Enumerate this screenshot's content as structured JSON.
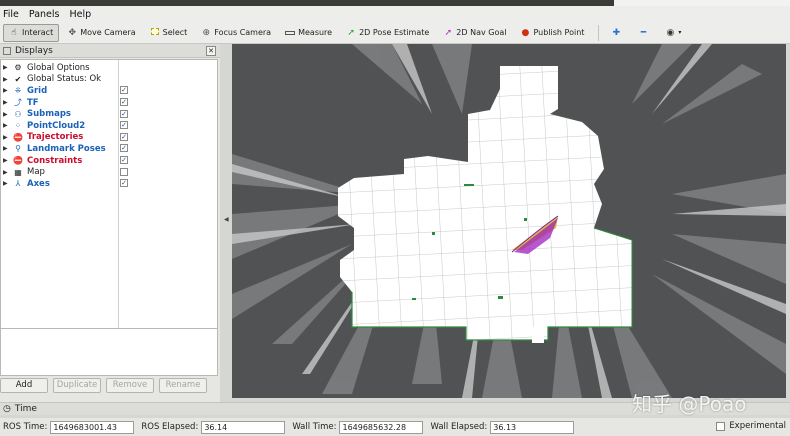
{
  "menu": {
    "file": "File",
    "panels": "Panels",
    "help": "Help"
  },
  "toolbar": {
    "interact": "Interact",
    "move_camera": "Move Camera",
    "select": "Select",
    "focus_camera": "Focus Camera",
    "measure": "Measure",
    "pose_estimate": "2D Pose Estimate",
    "nav_goal": "2D Nav Goal",
    "publish_point": "Publish Point"
  },
  "displays": {
    "title": "Displays",
    "items": [
      {
        "label": "Global Options",
        "icon": "gear-icon",
        "color": "#222222",
        "checkbox": false
      },
      {
        "label": "Global Status: Ok",
        "icon": "checkmark-icon",
        "color": "#222222",
        "checkbox": false
      },
      {
        "label": "Grid",
        "icon": "grid-icon",
        "color": "#1b62b8",
        "checkbox": true,
        "checked": true
      },
      {
        "label": "TF",
        "icon": "tf-icon",
        "color": "#1b62b8",
        "checkbox": true,
        "checked": true
      },
      {
        "label": "Submaps",
        "icon": "submaps-icon",
        "color": "#1b62b8",
        "checkbox": true,
        "checked": true
      },
      {
        "label": "PointCloud2",
        "icon": "pointcloud-icon",
        "color": "#1b62b8",
        "checkbox": true,
        "checked": true
      },
      {
        "label": "Trajectories",
        "icon": "error-icon",
        "color": "#c8102e",
        "checkbox": true,
        "checked": true
      },
      {
        "label": "Landmark Poses",
        "icon": "landmark-icon",
        "color": "#1b62b8",
        "checkbox": true,
        "checked": true
      },
      {
        "label": "Constraints",
        "icon": "error-icon",
        "color": "#c8102e",
        "checkbox": true,
        "checked": true
      },
      {
        "label": "Map",
        "icon": "map-icon",
        "color": "#222222",
        "checkbox": true,
        "checked": false
      },
      {
        "label": "Axes",
        "icon": "axes-icon",
        "color": "#1b62b8",
        "checkbox": true,
        "checked": true
      }
    ]
  },
  "buttons": {
    "add": "Add",
    "duplicate": "Duplicate",
    "remove": "Remove",
    "rename": "Rename"
  },
  "time_panel": {
    "title": "Time"
  },
  "status": {
    "ros_time_label": "ROS Time:",
    "ros_time": "1649683001.43",
    "ros_elapsed_label": "ROS Elapsed:",
    "ros_elapsed": "36.14",
    "wall_time_label": "Wall Time:",
    "wall_time": "1649685632.28",
    "wall_elapsed_label": "Wall Elapsed:",
    "wall_elapsed": "36.13",
    "experimental": "Experimental"
  },
  "watermark": "知乎 @Poao",
  "colors": {
    "viewport_bg": "#505254",
    "map_free": "#ffffff",
    "trajectory_yellow": "#d6b020",
    "trajectory_purple": "#a020c0"
  }
}
